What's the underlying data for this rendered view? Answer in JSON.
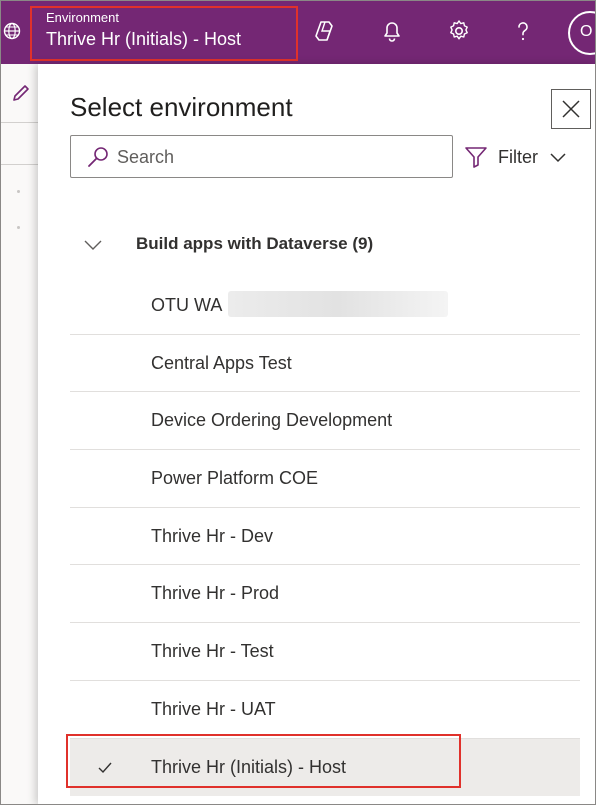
{
  "header": {
    "environment_caption": "Environment",
    "environment_name": "Thrive Hr (Initials) - Host",
    "icons": [
      "globe-icon",
      "copilot-icon",
      "bell-icon",
      "gear-icon",
      "help-icon",
      "avatar"
    ],
    "avatar_initials": "O"
  },
  "panel": {
    "title": "Select environment",
    "search": {
      "placeholder": "Search",
      "value": ""
    },
    "filter_label": "Filter",
    "group": {
      "label": "Build apps with Dataverse (9)",
      "expanded": true
    },
    "environments": [
      {
        "label": "OTU WA",
        "selected": false,
        "redacted_suffix": true
      },
      {
        "label": "Central Apps Test",
        "selected": false
      },
      {
        "label": "Device Ordering Development",
        "selected": false
      },
      {
        "label": "Power Platform COE",
        "selected": false
      },
      {
        "label": "Thrive Hr - Dev",
        "selected": false
      },
      {
        "label": "Thrive Hr - Prod",
        "selected": false
      },
      {
        "label": "Thrive Hr - Test",
        "selected": false
      },
      {
        "label": "Thrive Hr - UAT",
        "selected": false
      },
      {
        "label": "Thrive Hr (Initials) - Host",
        "selected": true
      }
    ]
  },
  "colors": {
    "topbar": "#742774",
    "highlight": "#e0312b",
    "selected_row": "#edebe9"
  }
}
